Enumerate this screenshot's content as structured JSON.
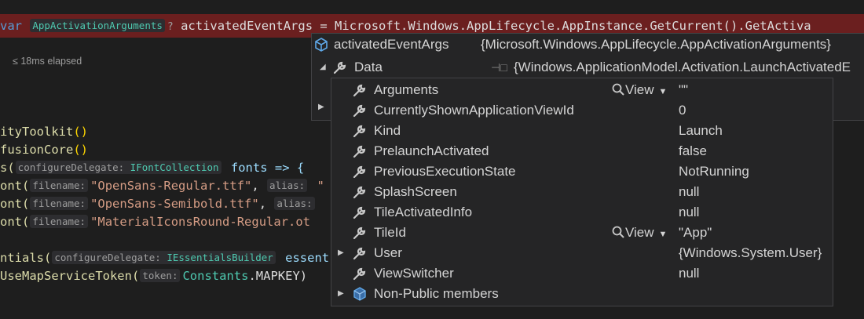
{
  "code": {
    "line0": {
      "kw": "var",
      "hint": "AppActivationArguments",
      "q": "?",
      "rest": " activatedEventArgs = Microsoft.Windows.AppLifecycle.AppInstance.GetCurrent().GetActiva"
    },
    "elapsed": "≤ 18ms elapsed",
    "line1": {
      "a": "ityToolkit",
      "b": "()"
    },
    "line2": {
      "a": "fusionCore",
      "b": "()"
    },
    "line3": {
      "p": "s(",
      "hint": "configureDelegate:",
      "hint_type": "IFontCollection",
      "b": " fonts => {"
    },
    "line4": {
      "p": "ont(",
      "hint": "filename:",
      "s": "\"OpenSans-Regular.ttf\"",
      "c": ", ",
      "hint2": "alias:",
      "s2": " \""
    },
    "line5": {
      "p": "ont(",
      "hint": "filename:",
      "s": "\"OpenSans-Semibold.ttf\"",
      "c": ", ",
      "hint2": "alias:"
    },
    "line6": {
      "p": "ont(",
      "hint": "filename:",
      "s": "\"MaterialIconsRound-Regular.ot"
    },
    "line7": {
      "p": "ntials(",
      "hint": "configureDelegate:",
      "hint_type": "IEssentialsBuilder",
      "b": " essent"
    },
    "line8": {
      "p": "UseMapServiceToken(",
      "hint": "token:",
      "t": "Constants",
      "d": ".MAPKEY)"
    }
  },
  "tooltip1": {
    "name": "activatedEventArgs",
    "value": "{Microsoft.Windows.AppLifecycle.AppActivationArguments}",
    "rows": [
      {
        "name": "Data",
        "value": "{Windows.ApplicationModel.Activation.LaunchActivatedE"
      }
    ]
  },
  "tooltip2": {
    "view_label": "View",
    "rows": [
      {
        "name": "Arguments",
        "value": "\"\"",
        "has_view": true,
        "expandable": false
      },
      {
        "name": "CurrentlyShownApplicationViewId",
        "value": "0",
        "has_view": false,
        "expandable": false
      },
      {
        "name": "Kind",
        "value": "Launch",
        "has_view": false,
        "expandable": false
      },
      {
        "name": "PrelaunchActivated",
        "value": "false",
        "has_view": false,
        "expandable": false
      },
      {
        "name": "PreviousExecutionState",
        "value": "NotRunning",
        "has_view": false,
        "expandable": false
      },
      {
        "name": "SplashScreen",
        "value": "null",
        "has_view": false,
        "expandable": false
      },
      {
        "name": "TileActivatedInfo",
        "value": "null",
        "has_view": false,
        "expandable": false
      },
      {
        "name": "TileId",
        "value": "\"App\"",
        "has_view": true,
        "expandable": false
      },
      {
        "name": "User",
        "value": "{Windows.System.User}",
        "has_view": false,
        "expandable": true
      },
      {
        "name": "ViewSwitcher",
        "value": "null",
        "has_view": false,
        "expandable": false
      },
      {
        "name": "Non-Public members",
        "value": "",
        "has_view": false,
        "expandable": true
      }
    ]
  },
  "colors": {
    "highlight": "#6b1f1f",
    "tooltip_bg": "#252526",
    "border": "#434346",
    "wrench": "#c8c8c8",
    "cube": "#5fa8e8"
  }
}
